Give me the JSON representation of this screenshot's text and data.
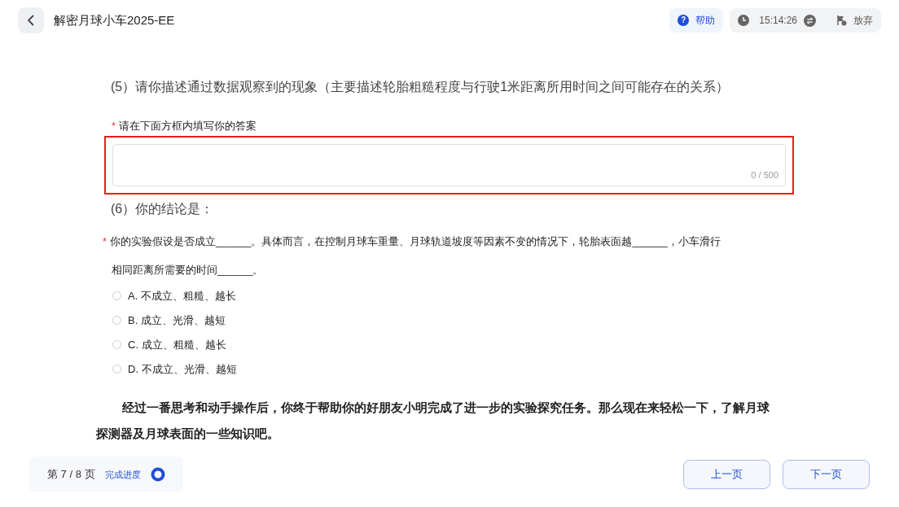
{
  "header": {
    "title": "解密月球小车2025-EE",
    "help_icon": "?",
    "help": "帮助",
    "time": "15:14:26",
    "quit": "放弃"
  },
  "q5": {
    "question": "(5）请你描述通过数据观察到的现象（主要描述轮胎粗糙程度与行驶1米距离所用时间之间可能存在的关系）",
    "required_mark": "*",
    "label": "请在下面方框内填写你的答案",
    "counter": "0 / 500",
    "highlighted": true
  },
  "q6": {
    "question": "(6）你的结论是：",
    "required_mark": "*",
    "prompt_line1": "你的实验假设是否成立______。具体而言，在控制月球车重量、月球轨道坡度等因素不变的情况下，轮胎表面越______，小车滑行",
    "prompt_line2": "相同距离所需要的时间______。",
    "options": [
      {
        "text": "A. 不成立、粗糙、越长",
        "selected": false
      },
      {
        "text": "B. 成立、光滑、越短",
        "selected": false
      },
      {
        "text": "C. 成立、粗糙、越长",
        "selected": false
      },
      {
        "text": "D. 不成立、光滑、越短",
        "selected": false
      }
    ]
  },
  "paragraph": "经过一番思考和动手操作后，你终于帮助你的好朋友小明完成了进一步的实验探究任务。那么现在来轻松一下，了解月球探测器及月球表面的一些知识吧。",
  "footer": {
    "page": "第 7 / 8 页",
    "progress_label": "完成进度",
    "prev": "上一页",
    "next": "下一页"
  }
}
